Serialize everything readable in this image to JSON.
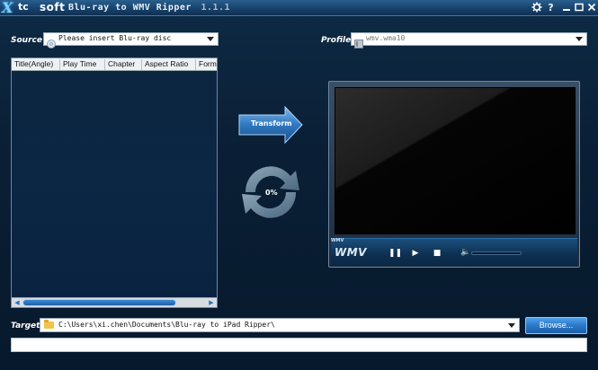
{
  "app": {
    "logo_x": "X",
    "logo_tc": "tc",
    "logo_soft": "soft",
    "title": "Blu-ray to WMV Ripper",
    "title_suffix": "1.1.1",
    "icons": [
      "settings-icon",
      "help-icon",
      "minimize-icon",
      "maximize-icon",
      "close-icon"
    ]
  },
  "source": {
    "label": "Source :",
    "value": "Please insert Blu-ray disc"
  },
  "profile": {
    "label": "Profile :",
    "value": "wmv.wma10"
  },
  "table": {
    "columns": [
      "Title(Angle)",
      "Play Time",
      "Chapter",
      "Aspect Ratio",
      "Form"
    ],
    "rows": []
  },
  "transform": {
    "label": "Transform",
    "progress_text": "0%"
  },
  "player": {
    "logo": "WMV",
    "logo_small": "WMV"
  },
  "target": {
    "label": "Target :",
    "path": "C:\\Users\\xi.chen\\Documents\\Blu-ray to iPad Ripper\\",
    "browse_label": "Browse..."
  },
  "progress": {
    "value": 0
  },
  "colors": {
    "accent": "#2a78c8",
    "background": "#0a1f36"
  }
}
